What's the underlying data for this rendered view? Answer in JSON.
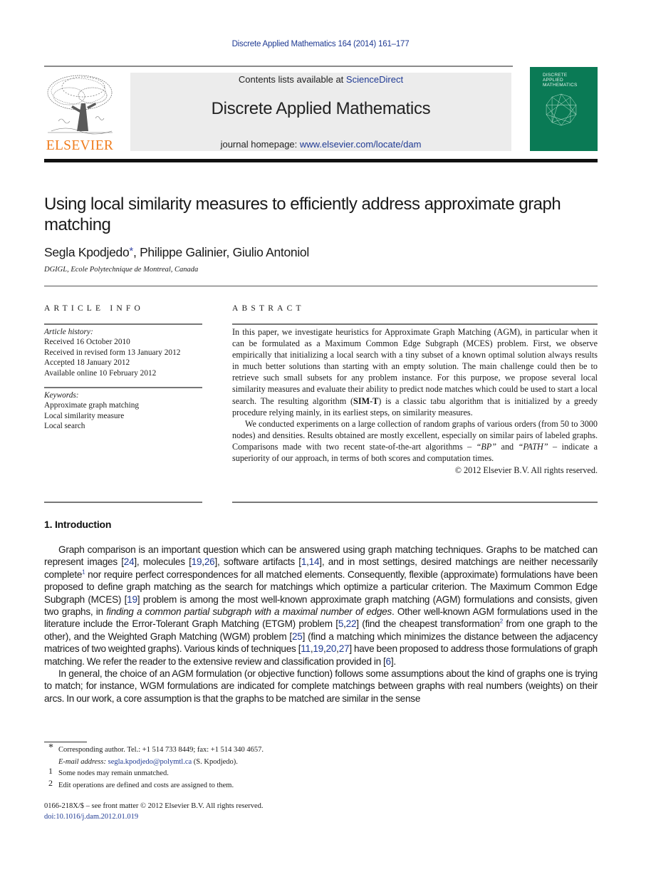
{
  "header": {
    "journal_ref": "Discrete Applied Mathematics 164 (2014) 161–177",
    "contents_prefix": "Contents lists available at ",
    "contents_link": "ScienceDirect",
    "journal_title": "Discrete Applied Mathematics",
    "homepage_prefix": "journal homepage: ",
    "homepage_link": "www.elsevier.com/locate/dam",
    "publisher_logo_text": "ELSEVIER",
    "cover_title_lines": [
      "DISCRETE",
      "APPLIED",
      "MATHEMATICS"
    ],
    "colors": {
      "link": "#1f3a93",
      "elsevier_orange": "#f07d1e",
      "cover_green": "#0a7a55",
      "band_gray": "#ececec"
    }
  },
  "article": {
    "title": "Using local similarity measures to efficiently address approximate graph matching",
    "authors": [
      {
        "name": "Segla Kpodjedo",
        "mark": "*"
      },
      {
        "name": "Philippe Galinier",
        "mark": ""
      },
      {
        "name": "Giulio Antoniol",
        "mark": ""
      }
    ],
    "author_separator": ", ",
    "affiliation": "DGIGL, Ecole Polytechnique de Montreal, Canada"
  },
  "article_info": {
    "label": "ARTICLE INFO",
    "history_heading": "Article history:",
    "history": [
      "Received 16 October 2010",
      "Received in revised form 13 January 2012",
      "Accepted 18 January 2012",
      "Available online 10 February 2012"
    ],
    "keywords_heading": "Keywords:",
    "keywords": [
      "Approximate graph matching",
      "Local similarity measure",
      "Local search"
    ]
  },
  "abstract": {
    "label": "ABSTRACT",
    "p1_a": "In this paper, we investigate heuristics for Approximate Graph Matching (AGM), in particular when it can be formulated as a Maximum Common Edge Subgraph (MCES) problem. First, we observe empirically that initializing a local search with a tiny subset of a known optimal solution always results in much better solutions than starting with an empty solution. The main challenge could then be to retrieve such small subsets for any problem instance. For this purpose, we propose several local similarity measures and evaluate their ability to predict node matches which could be used to start a local search. The resulting algorithm (",
    "p1_bold": "SIM-T",
    "p1_b": ") is a classic tabu algorithm that is initialized by a greedy procedure relying mainly, in its earliest steps, on similarity measures.",
    "p2_a": "We conducted experiments on a large collection of random graphs of various orders (from 50 to 3000 nodes) and densities. Results obtained are mostly excellent, especially on similar pairs of labeled graphs. Comparisons made with two recent state-of-the-art algorithms – ",
    "p2_bp": "“BP”",
    "p2_and": " and ",
    "p2_path": "“PATH”",
    "p2_b": " – indicate a superiority of our approach, in terms of both scores and computation times.",
    "copyright": "© 2012 Elsevier B.V. All rights reserved."
  },
  "introduction": {
    "heading": "1.  Introduction",
    "p1": {
      "t1": "Graph comparison is an important question which can be answered using graph matching techniques. Graphs to be matched can represent images [",
      "r1": "24",
      "t2": "], molecules [",
      "r2": "19",
      "t2b": ",",
      "r3": "26",
      "t3": "], software artifacts [",
      "r4": "1",
      "t3b": ",",
      "r5": "14",
      "t4": "], and in most settings, desired matchings are neither necessarily complete",
      "fn1": "1",
      "t5": " nor require perfect correspondences for all matched elements. Consequently, flexible (approximate) formulations have been proposed to define graph matching as the search for matchings which optimize a particular criterion. The Maximum Common Edge Subgraph (MCES) [",
      "r6": "19",
      "t6": "] problem is among the most well-known approximate graph matching (AGM) formulations and consists, given two graphs, in ",
      "italic": "finding a common partial subgraph with a maximal number of edges",
      "t7": ". Other well-known AGM formulations used in the literature include the Error-Tolerant Graph Matching (ETGM) problem [",
      "r7": "5",
      "t7b": ",",
      "r8": "22",
      "t8": "] (find the cheapest transformation",
      "fn2": "2",
      "t9": " from one graph to the other), and the Weighted Graph Matching (WGM) problem [",
      "r9": "25",
      "t10": "] (find a matching which minimizes the distance between the adjacency matrices of two weighted graphs). Various kinds of techniques [",
      "r10": "11",
      "c1": ",",
      "r11": "19",
      "c2": ",",
      "r12": "20",
      "c3": ",",
      "r13": "27",
      "t11": "] have been proposed to address those formulations of graph matching. We refer the reader to the extensive review and classification provided in [",
      "r14": "6",
      "t12": "]."
    },
    "p2": "In general, the choice of an AGM formulation (or objective function) follows some assumptions about the kind of graphs one is trying to match; for instance, WGM formulations are indicated for complete matchings between graphs with real numbers (weights) on their arcs. In our work, a core assumption is that the graphs to be matched are similar in the sense"
  },
  "footnotes": {
    "star_mark": "*",
    "corresponding": "Corresponding author. Tel.: +1 514 733 8449; fax: +1 514 340 4657.",
    "email_label": "E-mail address: ",
    "email": "segla.kpodjedo@polymtl.ca",
    "email_suffix": " (S. Kpodjedo).",
    "fn1_mark": "1",
    "fn1": "Some nodes may remain unmatched.",
    "fn2_mark": "2",
    "fn2": "Edit operations are defined and costs are assigned to them.",
    "front_matter": "0166-218X/$ – see front matter © 2012 Elsevier B.V. All rights reserved.",
    "doi": "doi:10.1016/j.dam.2012.01.019"
  }
}
